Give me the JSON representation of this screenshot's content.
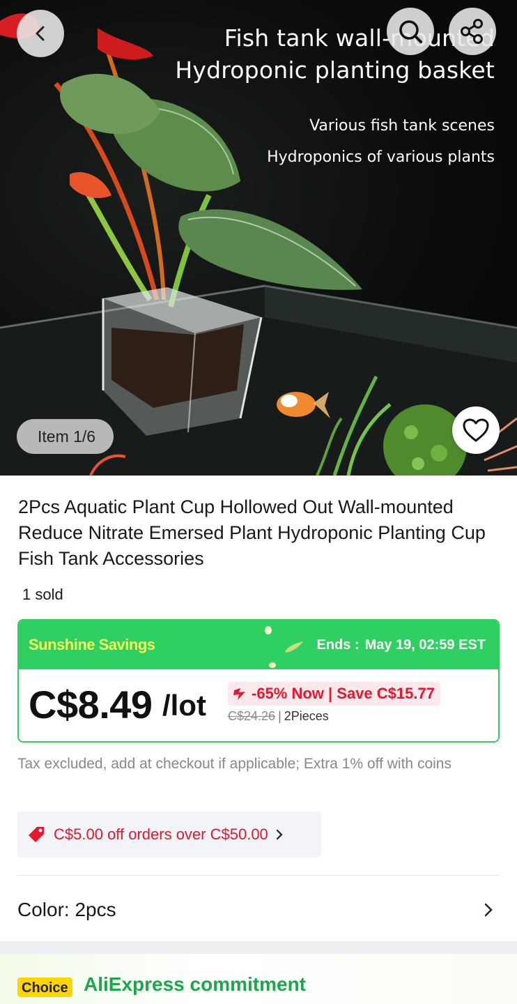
{
  "hero": {
    "title_line1": "Fish tank wall-mounted",
    "title_line2": "Hydroponic planting basket",
    "subtitle1": "Various fish tank scenes",
    "subtitle2": "Hydroponics of various plants",
    "item_counter": "Item 1/6"
  },
  "icons": {
    "back": "chevron-left-icon",
    "search": "search-icon",
    "share": "share-icon",
    "favorite": "heart-icon",
    "coupon": "tag-icon",
    "discount": "down-arrow-icon"
  },
  "product": {
    "title": "2Pcs Aquatic Plant Cup Hollowed Out Wall-mounted Reduce Nitrate Emersed Plant Hydroponic Planting Cup Fish Tank Accessories",
    "sold": "1 sold"
  },
  "deal": {
    "name": "Sunshine Savings",
    "ends_label": "Ends :",
    "ends_value": "May 19, 02:59 EST",
    "price": "C$8.49",
    "unit": "/lot",
    "discount_text": "-65% Now | Save C$15.77",
    "original_price": "C$24.26",
    "separator": "|",
    "pieces": "2Pieces"
  },
  "tax_note": "Tax excluded, add at checkout if applicable; Extra 1% off with coins",
  "coupon": {
    "text": "C$5.00 off orders over C$50.00"
  },
  "color": {
    "label": "Color: 2pcs"
  },
  "commitment": {
    "badge": "Choice",
    "title": "AliExpress commitment"
  },
  "colors": {
    "accent_green": "#2fcf61",
    "sale_red": "#e6162d",
    "choice_yellow": "#ffd400"
  }
}
